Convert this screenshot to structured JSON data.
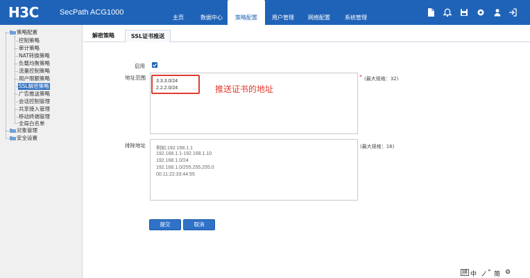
{
  "header": {
    "logo": "H3C",
    "product": "SecPath ACG1000",
    "nav": [
      "主页",
      "数据中心",
      "策略配置",
      "用户管理",
      "网络配置",
      "系统管理"
    ],
    "active_nav": "策略配置",
    "tool_icons": [
      "document-icon",
      "bell-icon",
      "save-icon",
      "settings-icon",
      "user-icon",
      "logout-icon"
    ]
  },
  "sidebar": {
    "root": "策略配置",
    "children": [
      "控制策略",
      "审计策略",
      "NAT转换策略",
      "负载均衡策略",
      "流量控制策略",
      "用户限额策略",
      "SSL解密策略",
      "广告推送策略",
      "会话控制管理",
      "共享接入管理",
      "移动终端管理",
      "全局白名单"
    ],
    "selected": "SSL解密策略",
    "siblings": [
      "对象管理",
      "安全设置"
    ]
  },
  "tabs": [
    "解密策略",
    "SSL证书推送"
  ],
  "active_tab": "SSL证书推送",
  "form": {
    "enable_label": "启用",
    "enabled": true,
    "address_label": "地址范围",
    "address_lines": [
      "3.3.3.0/24",
      "2.2.2.0/24"
    ],
    "address_required": "*",
    "address_hint": "(最大规格：32)",
    "exclude_label": "排除地址",
    "exclude_placeholder": [
      "例如:192.168.1.1",
      "192.168.1.1-192.168.1.10",
      "192.168.1.0/24",
      "192.168.1.0/255.255.255.0",
      "00:11:22:33:44:55"
    ],
    "exclude_hint": "(最大规格：16)",
    "submit_label": "提交",
    "cancel_label": "取消"
  },
  "annotation": "推送证书的地址",
  "ime": [
    "拼",
    "中",
    "ノ",
    "°",
    "简",
    "⚙"
  ],
  "colors": {
    "header_bg": "#1f63b8",
    "accent": "#2f72c8",
    "annotation_red": "#e03a2f",
    "sidebar_bg": "#f0f0f0"
  }
}
